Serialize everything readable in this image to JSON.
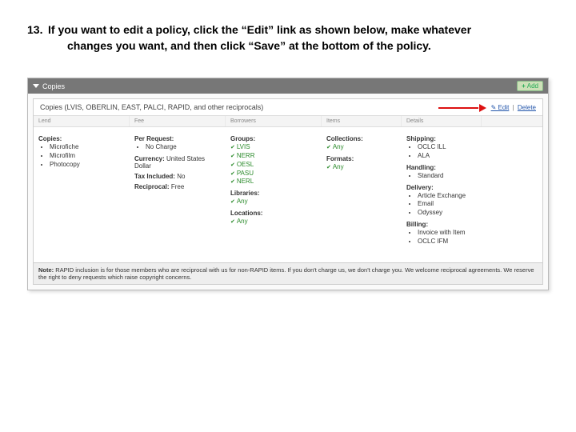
{
  "instruction": {
    "number": "13.",
    "line1": "If you want to edit a policy, click the “Edit” link as shown below, make whatever",
    "line2": "changes you want, and then click “Save” at the bottom of the policy."
  },
  "topbar": {
    "title": "Copies",
    "add_label": "Add"
  },
  "panel": {
    "title": "Copies (LVIS, OBERLIN, EAST, PALCI, RAPID, and other reciprocals)",
    "edit_label": "Edit",
    "delete_label": "Delete"
  },
  "columns": {
    "c1": "Lend",
    "c2": "Fee",
    "c3": "Borrowers",
    "c4": "Items",
    "c5": "Details"
  },
  "col1": {
    "hd": "Copies:",
    "items": [
      "Microfiche",
      "Microfilm",
      "Photocopy"
    ]
  },
  "col2": {
    "hd1": "Per Request:",
    "i1": "No Charge",
    "hd2": "Currency:",
    "v2": "United States Dollar",
    "hd3": "Tax Included:",
    "v3": "No",
    "hd4": "Reciprocal:",
    "v4": "Free"
  },
  "col3": {
    "groups_hd": "Groups:",
    "groups": [
      "LVIS",
      "NERR",
      "OESL",
      "PASU",
      "NERL"
    ],
    "libraries_hd": "Libraries:",
    "any": "Any",
    "locations_hd": "Locations:"
  },
  "col4": {
    "collections_hd": "Collections:",
    "any": "Any",
    "formats_hd": "Formats:"
  },
  "col5": {
    "shipping_hd": "Shipping:",
    "shipping": [
      "OCLC ILL",
      "ALA"
    ],
    "handling_hd": "Handling:",
    "handling": [
      "Standard"
    ],
    "delivery_hd": "Delivery:",
    "delivery": [
      "Article Exchange",
      "Email",
      "Odyssey"
    ],
    "billing_hd": "Billing:",
    "billing": [
      "Invoice with Item",
      "OCLC IFM"
    ]
  },
  "note": {
    "label": "Note:",
    "text": "RAPID inclusion is for those members who are reciprocal with us for non-RAPID items. If you don't charge us, we don't charge you. We welcome reciprocal agreements. We reserve the right to deny requests which raise copyright concerns."
  }
}
